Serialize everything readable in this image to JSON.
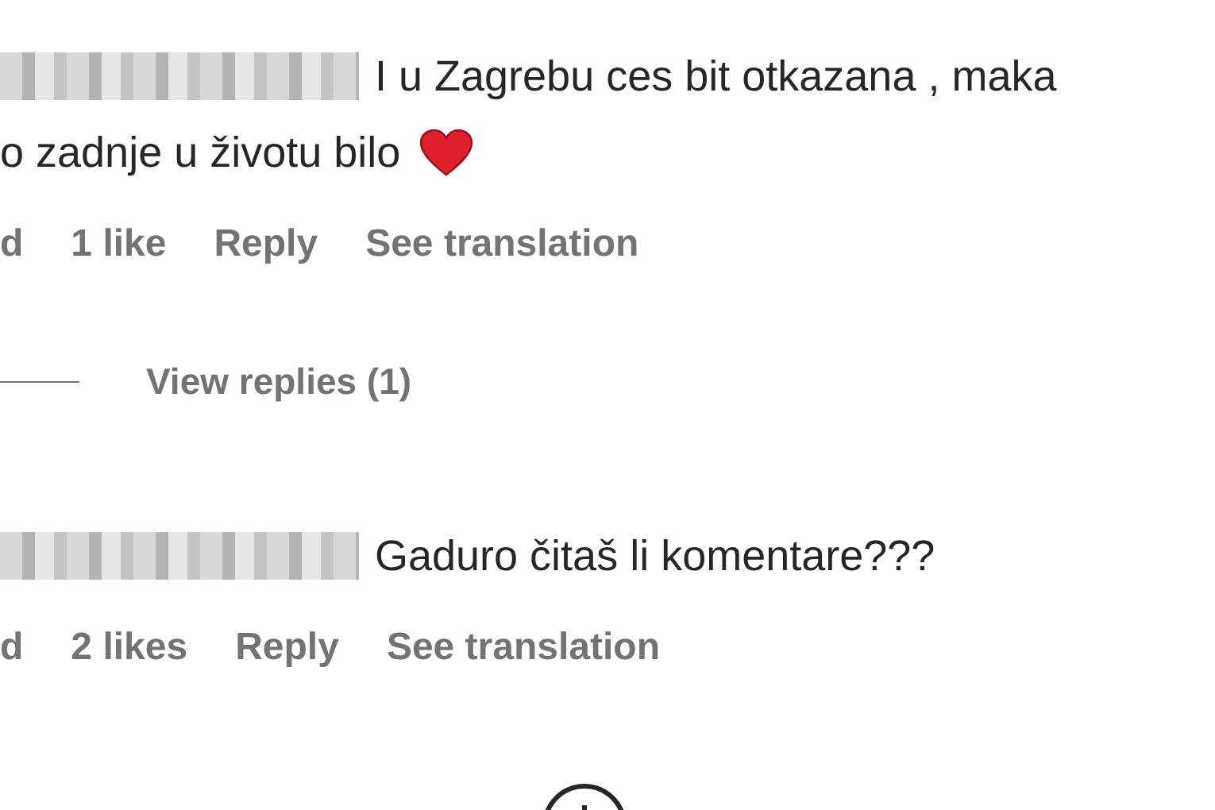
{
  "comments": [
    {
      "lines": [
        "I u Zagrebu ces bit otkazana , maka",
        "o zadnje u životu bilo"
      ],
      "heart": true,
      "meta": {
        "time": "d",
        "likes": "1 like",
        "reply": "Reply",
        "translate": "See translation"
      },
      "view_replies": "View replies (1)"
    },
    {
      "lines": [
        "Gaduro čitaš li komentare???"
      ],
      "heart": false,
      "meta": {
        "time": "d",
        "likes": "2 likes",
        "reply": "Reply",
        "translate": "See translation"
      }
    }
  ]
}
